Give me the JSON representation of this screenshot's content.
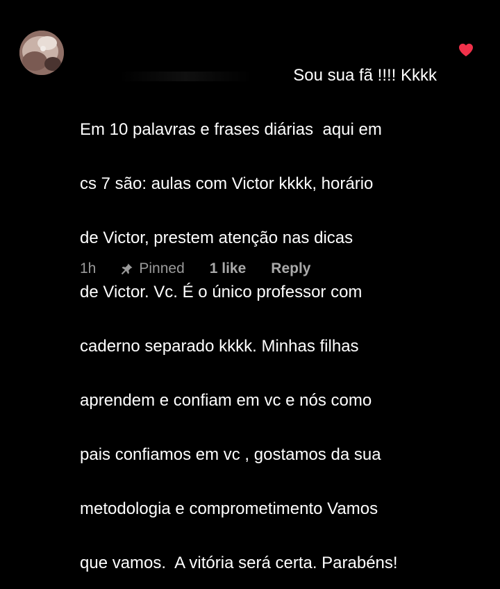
{
  "comment": {
    "lines": [
      "Sou sua fã !!!! Kkkk",
      "Em 10 palavras e frases diárias  aqui em",
      "cs 7 são: aulas com Victor kkkk, horário",
      "de Victor, prestem atenção nas dicas",
      "de Victor. Vc. É o único professor com",
      "caderno separado kkkk. Minhas filhas",
      "aprendem e confiam em vc e nós como",
      "pais confiamos em vc , gostamos da sua",
      "metodologia e comprometimento Vamos",
      "que vamos.  A vitória será certa. Parabéns!"
    ],
    "time": "1h",
    "pinned_label": "Pinned",
    "likes_label": "1 like",
    "reply_label": "Reply",
    "liked": true
  },
  "icons": {
    "heart": "heart-icon",
    "pin": "pin-icon",
    "avatar": "avatar"
  },
  "colors": {
    "background": "#000000",
    "text": "#ffffff",
    "meta": "#9a9a9a",
    "heart": "#f0314a"
  }
}
